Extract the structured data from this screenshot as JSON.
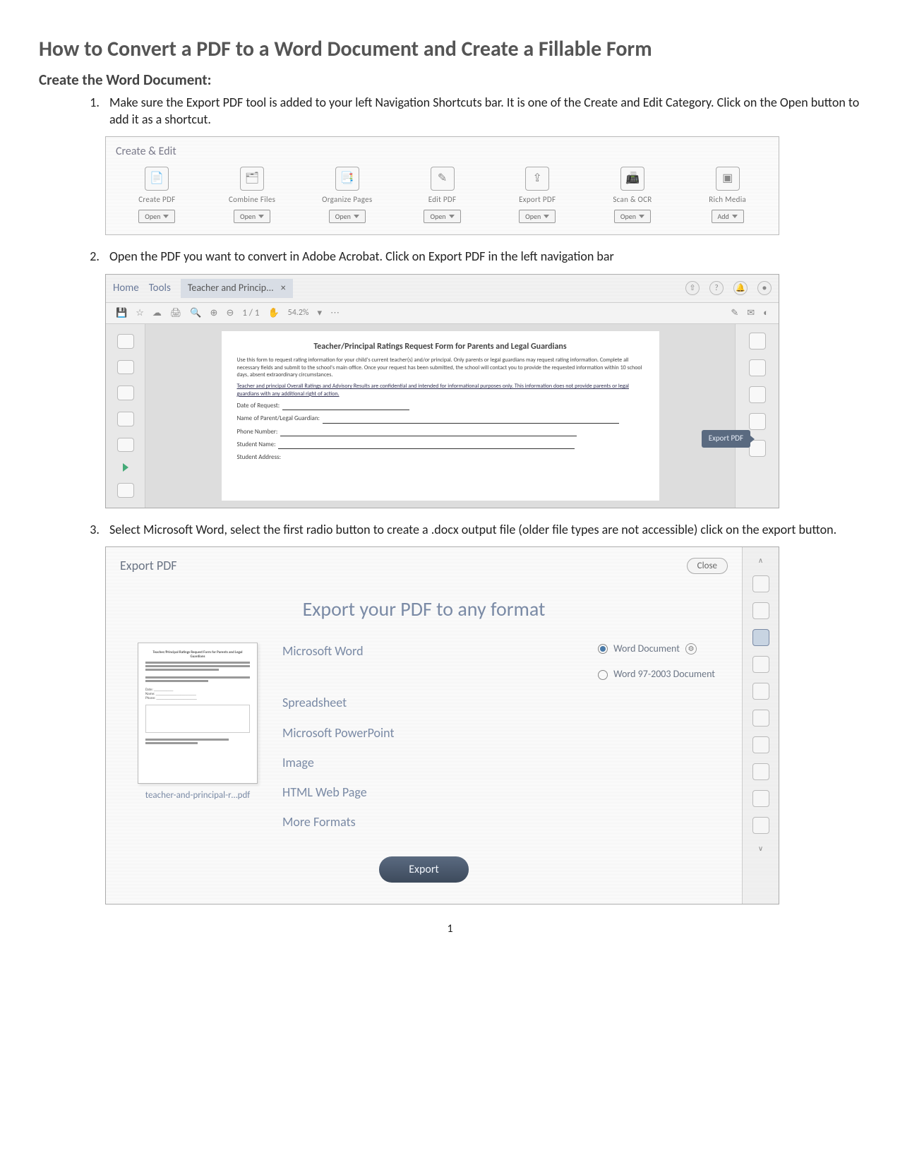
{
  "title": "How to Convert a PDF to a Word Document and Create a Fillable Form",
  "section_heading": "Create the Word Document:",
  "steps": [
    "Make sure the Export PDF tool is added to your left Navigation Shortcuts bar. It is one of the Create and Edit Category.  Click on the Open button to add it as a shortcut.",
    "Open the PDF you want to convert in Adobe Acrobat.  Click on Export PDF in the left navigation bar",
    "Select Microsoft Word, select the first radio button to create a .docx output file (older file types are not accessible) click on the export button."
  ],
  "fig1": {
    "panel_title": "Create & Edit",
    "tools": [
      {
        "label": "Create PDF",
        "glyph": "📄",
        "btn": "Open"
      },
      {
        "label": "Combine Files",
        "glyph": "🗂",
        "btn": "Open"
      },
      {
        "label": "Organize Pages",
        "glyph": "📑",
        "btn": "Open"
      },
      {
        "label": "Edit PDF",
        "glyph": "✎",
        "btn": "Open"
      },
      {
        "label": "Export PDF",
        "glyph": "⇪",
        "btn": "Open"
      },
      {
        "label": "Scan & OCR",
        "glyph": "📠",
        "btn": "Open"
      },
      {
        "label": "Rich Media",
        "glyph": "▣",
        "btn": "Add"
      }
    ]
  },
  "fig2": {
    "home": "Home",
    "tools": "Tools",
    "doc_tab": "Teacher and Princip...",
    "zoom": "54.2%",
    "page_indicator": "1 / 1",
    "callout": "Export PDF",
    "page": {
      "heading": "Teacher/Principal Ratings Request Form for Parents and Legal Guardians",
      "p1": "Use this form to request rating information for your child's current teacher(s) and/or principal. Only parents or legal guardians may request rating information. Complete all necessary fields and submit to the school's main office. Once your request has been submitted, the school will contact you to provide the requested information within 10 school days, absent extraordinary circumstances.",
      "p2": "Teacher and principal Overall Ratings and Advisory Results are confidential and intended for informational purposes only. This information does not provide parents or legal guardians with any additional right of action.",
      "fields": [
        "Date of Request:",
        "Name of Parent/Legal Guardian:",
        "Phone Number:",
        "Student Name:",
        "Student Address:"
      ]
    }
  },
  "fig3": {
    "title": "Export PDF",
    "close": "Close",
    "heading": "Export your PDF to any format",
    "thumb_filename": "teacher-and-principal-r…pdf",
    "formats": [
      "Microsoft Word",
      "Spreadsheet",
      "Microsoft PowerPoint",
      "Image",
      "HTML Web Page",
      "More Formats"
    ],
    "sub": [
      {
        "label": "Word Document",
        "checked": true,
        "gear": true
      },
      {
        "label": "Word 97-2003 Document",
        "checked": false,
        "gear": false
      }
    ],
    "export_btn": "Export"
  },
  "page_number": "1"
}
